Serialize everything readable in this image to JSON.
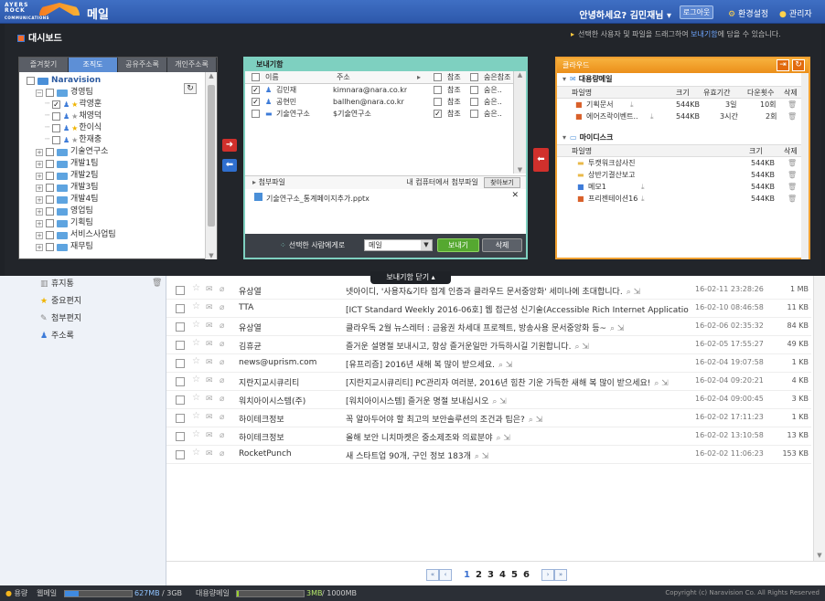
{
  "topbar": {
    "logo_line1": "AYERS",
    "logo_line2": "ROCK",
    "logo_sub": "COMMUNICATIONS",
    "app_name": "메일",
    "greeting": "안녕하세요? 김민재님 ▾",
    "logout": "로그아웃",
    "settings": "환경설정",
    "admin": "관리자"
  },
  "dashboard": {
    "title": "대시보드",
    "hint_pre": "선택한 사용자 및 파일을 드래그하여 ",
    "hint_link": "보내기함",
    "hint_post": "에 담을 수 있습니다.",
    "close_label": "보내기함 닫기 ▴"
  },
  "org": {
    "tabs": [
      "즐겨찾기",
      "조직도",
      "공유주소록",
      "개인주소록"
    ],
    "active_tab": 1,
    "tree": [
      {
        "label": "Naravision",
        "type": "root",
        "indent": 0
      },
      {
        "label": "경영팀",
        "type": "folder",
        "indent": 1
      },
      {
        "label": "곽영훈",
        "type": "person",
        "indent": 2,
        "checked": true,
        "star": true
      },
      {
        "label": "채영덕",
        "type": "person",
        "indent": 2,
        "checked": false,
        "star": false
      },
      {
        "label": "한이식",
        "type": "person",
        "indent": 2,
        "checked": false,
        "star": true
      },
      {
        "label": "한재충",
        "type": "person",
        "indent": 2,
        "checked": false,
        "star": false
      },
      {
        "label": "기술연구소",
        "type": "folder",
        "indent": 1
      },
      {
        "label": "개발1팀",
        "type": "folder",
        "indent": 1
      },
      {
        "label": "개발2팀",
        "type": "folder",
        "indent": 1
      },
      {
        "label": "개발3팀",
        "type": "folder",
        "indent": 1
      },
      {
        "label": "개발4팀",
        "type": "folder",
        "indent": 1
      },
      {
        "label": "영업팀",
        "type": "folder",
        "indent": 1
      },
      {
        "label": "기획팀",
        "type": "folder",
        "indent": 1
      },
      {
        "label": "서비스사업팀",
        "type": "folder",
        "indent": 1
      },
      {
        "label": "재무팀",
        "type": "folder",
        "indent": 1
      }
    ]
  },
  "send": {
    "title": "보내기함",
    "columns": {
      "name": "이름",
      "address": "주소",
      "ref": "참조",
      "hidden_ref": "숨은참조"
    },
    "rows": [
      {
        "name": "김민재",
        "address": "kimnara@nara.co.kr",
        "ref": "참조",
        "hidden": "숨은..",
        "checked": true,
        "ref_on": false
      },
      {
        "name": "공현민",
        "address": "ballhen@nara.co.kr",
        "ref": "참조",
        "hidden": "숨은..",
        "checked": true,
        "ref_on": false
      },
      {
        "name": "기술연구소",
        "address": "$기술연구소",
        "ref": "참조",
        "hidden": "숨은..",
        "checked": false,
        "ref_on": true
      }
    ],
    "attach_label": "첨부파일",
    "attach_pc": "내 컴퓨터에서 첨부파일",
    "find_btn": "찾아보기",
    "attach_file": "기술연구소_통계페이지추가.pptx",
    "footer_label": "선택한 사람에게로",
    "select_value": "메일",
    "send_btn": "보내기",
    "delete_btn": "삭제"
  },
  "cloud": {
    "title": "클라우드",
    "sections": [
      {
        "title": "대용량메일",
        "headers": [
          "파일명",
          "크기",
          "유효기간",
          "다운횟수",
          "삭제"
        ],
        "rows": [
          {
            "name": "기획문서",
            "size": "544KB",
            "period": "3일",
            "downloads": "10회"
          },
          {
            "name": "에어즈락이벤트..",
            "size": "544KB",
            "period": "3시간",
            "downloads": "2회"
          }
        ]
      },
      {
        "title": "마이디스크",
        "headers": [
          "파일명",
          "크기",
          "삭제"
        ],
        "rows": [
          {
            "name": "투캣워크샵사진",
            "size": "544KB",
            "kind": "folder"
          },
          {
            "name": "상반기결산보고",
            "size": "544KB",
            "kind": "folder"
          },
          {
            "name": "메모1",
            "size": "544KB",
            "kind": "doc"
          },
          {
            "name": "프리젠테이션16",
            "size": "544KB",
            "kind": "ppt"
          }
        ]
      }
    ]
  },
  "sidebar": {
    "items": [
      {
        "label": "휴지통",
        "icon": "trash"
      },
      {
        "label": "중요편지",
        "icon": "star"
      },
      {
        "label": "첨부편지",
        "icon": "clip"
      },
      {
        "label": "주소록",
        "icon": "person"
      }
    ]
  },
  "mails": [
    {
      "from": "유상열",
      "subject": "넷아이디, '사용자&기타 접계 인증과 클라우드 문서중앙화' 세미나에 초대합니다.",
      "date": "16-02-11 23:28:26",
      "size": "1 MB"
    },
    {
      "from": "TTA",
      "subject": "[ICT Standard Weekly 2016-06호] 웹 접근성 신기술(Accessible Rich Internet Application, A…",
      "date": "16-02-10 08:46:58",
      "size": "11 KB"
    },
    {
      "from": "유상열",
      "subject": "클라우독 2월 뉴스레터 : 금융권 차세대 프로젝트, 방송사용 문서중앙화 등~",
      "date": "16-02-06 02:35:32",
      "size": "84 KB"
    },
    {
      "from": "김휴균",
      "subject": "즐거운 설명절 보내시고, 항상 즐거운일만 가득하시길 기원합니다.",
      "date": "16-02-05 17:55:27",
      "size": "49 KB"
    },
    {
      "from": "news@uprism.com",
      "subject": "[유프리즘] 2016년 새해 복 많이 받으세요.",
      "date": "16-02-04 19:07:58",
      "size": "1 KB"
    },
    {
      "from": "지란지교시큐리티",
      "subject": "[지란지교시큐리티] PC관리자 여러분, 2016년 힘찬 기운 가득한 새해 복 많이 받으세요!",
      "date": "16-02-04 09:20:21",
      "size": "4 KB"
    },
    {
      "from": "워치아이시스템(주)",
      "subject": "[워치아이시스템] 즐거운 명절 보내십시오",
      "date": "16-02-04 09:00:45",
      "size": "3 KB"
    },
    {
      "from": "하이테크정보",
      "subject": "꼭 알아두어야 할 최고의 보안솔루션의 조건과 팁은?",
      "date": "16-02-02 17:11:23",
      "size": "1 KB"
    },
    {
      "from": "하이테크정보",
      "subject": "올해 보안 니치마켓은 중소제조와 의료분야",
      "date": "16-02-02 13:10:58",
      "size": "13 KB"
    },
    {
      "from": "RocketPunch",
      "subject": "새 스타트업 90개, 구인 정보 183개",
      "date": "16-02-02 11:06:23",
      "size": "153 KB"
    }
  ],
  "pager": {
    "pages": [
      "1",
      "2",
      "3",
      "4",
      "5",
      "6"
    ],
    "current": "1"
  },
  "status": {
    "label": "용량",
    "web_label": "웹메일",
    "web_used": "627MB",
    "web_total": "/ 3GB",
    "web_fraction": 0.2,
    "big_label": "대용량메일",
    "big_used": "3MB",
    "big_total": "/ 1000MB",
    "big_fraction": 0.003,
    "copyright": "Copyright (c) Naravision Co. All Rights Reserved"
  },
  "colors": {
    "accent": "#3a70d0",
    "send_border": "#7ed0c0",
    "cloud_border": "#f0a030",
    "arrow_red": "#d0302c",
    "arrow_blue": "#2f6fcf",
    "bar_web": "#3f8ae0",
    "bar_big": "#9ad12f"
  }
}
